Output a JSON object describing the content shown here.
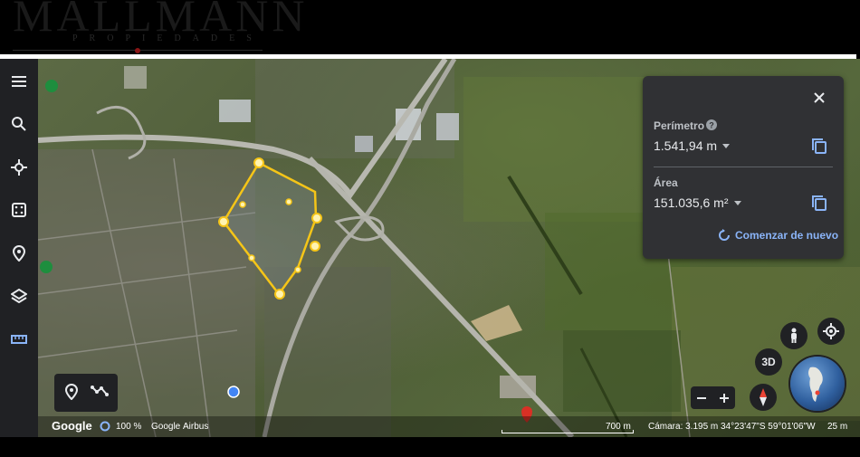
{
  "watermark": {
    "title": "MALLMANN",
    "subtitle": "PROPIEDADES"
  },
  "sidebar": {
    "items": [
      {
        "icon": "menu-icon"
      },
      {
        "icon": "search-icon"
      },
      {
        "icon": "voyager-icon"
      },
      {
        "icon": "dice-icon"
      },
      {
        "icon": "location-pin-icon"
      },
      {
        "icon": "layers-icon"
      },
      {
        "icon": "ruler-icon"
      }
    ]
  },
  "measure_panel": {
    "perimeter_label": "Perímetro",
    "perimeter_value": "1.541,94 m",
    "area_label": "Área",
    "area_value": "151.035,6 m²",
    "restart_label": "Comenzar de nuevo"
  },
  "controls": {
    "three_d_label": "3D"
  },
  "status_bar": {
    "google": "Google",
    "zoom_percent": "100 %",
    "attribution_google": "Google",
    "attribution_airbus": "Airbus",
    "scale": "700 m",
    "camera": "Cámara: 3.195 m",
    "coordinates": "34°23'47\"S 59°01'06\"W",
    "elevation": "25 m"
  },
  "colors": {
    "panel_bg": "#303134",
    "accent": "#8ab4f8",
    "polygon": "#f5c518",
    "sidebar_bg": "#202124"
  }
}
